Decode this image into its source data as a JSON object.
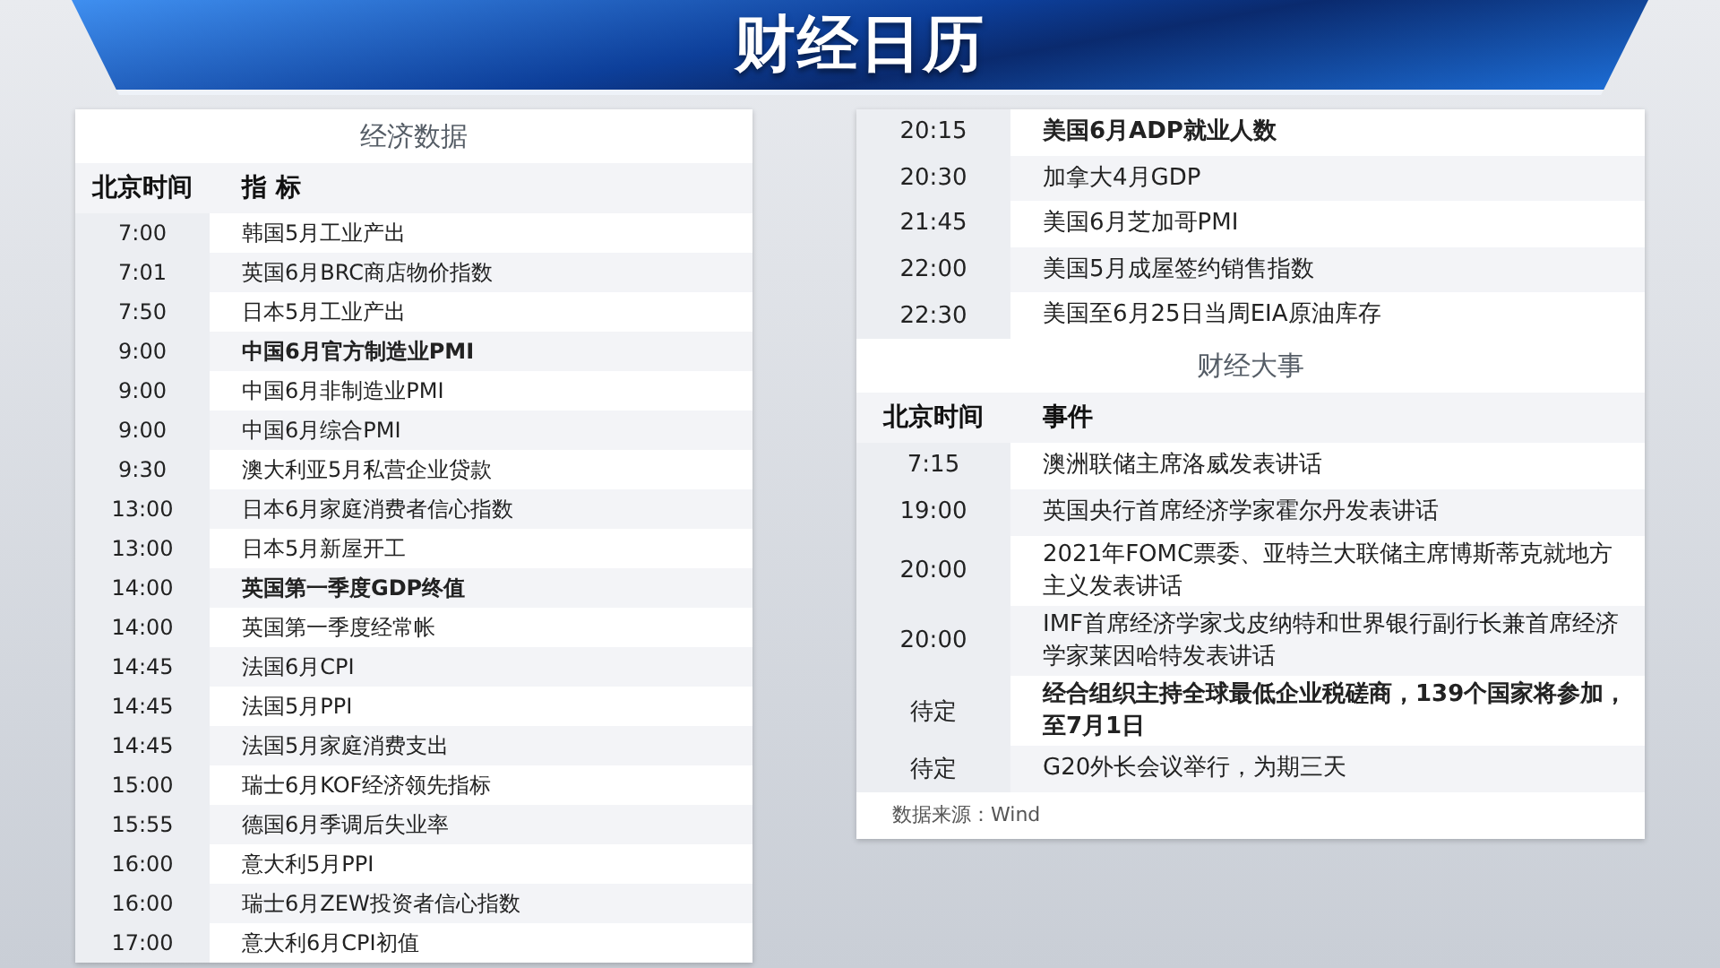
{
  "banner": {
    "title": "财经日历"
  },
  "economic_data": {
    "title": "经济数据",
    "columns": [
      "北京时间",
      "指 标"
    ],
    "rows": [
      {
        "time": "7:00",
        "item": "韩国5月工业产出",
        "bold": false
      },
      {
        "time": "7:01",
        "item": "英国6月BRC商店物价指数",
        "bold": false
      },
      {
        "time": "7:50",
        "item": "日本5月工业产出",
        "bold": false
      },
      {
        "time": "9:00",
        "item": "中国6月官方制造业PMI",
        "bold": true
      },
      {
        "time": "9:00",
        "item": "中国6月非制造业PMI",
        "bold": false
      },
      {
        "time": "9:00",
        "item": "中国6月综合PMI",
        "bold": false
      },
      {
        "time": "9:30",
        "item": "澳大利亚5月私营企业贷款",
        "bold": false
      },
      {
        "time": "13:00",
        "item": "日本6月家庭消费者信心指数",
        "bold": false
      },
      {
        "time": "13:00",
        "item": "日本5月新屋开工",
        "bold": false
      },
      {
        "time": "14:00",
        "item": "英国第一季度GDP终值",
        "bold": true
      },
      {
        "time": "14:00",
        "item": "英国第一季度经常帐",
        "bold": false
      },
      {
        "time": "14:45",
        "item": "法国6月CPI",
        "bold": false
      },
      {
        "time": "14:45",
        "item": "法国5月PPI",
        "bold": false
      },
      {
        "time": "14:45",
        "item": "法国5月家庭消费支出",
        "bold": false
      },
      {
        "time": "15:00",
        "item": "瑞士6月KOF经济领先指标",
        "bold": false
      },
      {
        "time": "15:55",
        "item": "德国6月季调后失业率",
        "bold": false
      },
      {
        "time": "16:00",
        "item": "意大利5月PPI",
        "bold": false
      },
      {
        "time": "16:00",
        "item": "瑞士6月ZEW投资者信心指数",
        "bold": false
      },
      {
        "time": "17:00",
        "item": "意大利6月CPI初值",
        "bold": false
      }
    ]
  },
  "economic_data_continued": {
    "rows": [
      {
        "time": "20:15",
        "item": "美国6月ADP就业人数",
        "bold": true
      },
      {
        "time": "20:30",
        "item": "加拿大4月GDP",
        "bold": false
      },
      {
        "time": "21:45",
        "item": "美国6月芝加哥PMI",
        "bold": false
      },
      {
        "time": "22:00",
        "item": "美国5月成屋签约销售指数",
        "bold": false
      },
      {
        "time": "22:30",
        "item": "美国至6月25日当周EIA原油库存",
        "bold": false
      }
    ]
  },
  "financial_events": {
    "title": "财经大事",
    "columns": [
      "北京时间",
      "事件"
    ],
    "rows": [
      {
        "time": "7:15",
        "item": "澳洲联储主席洛威发表讲话",
        "bold": false
      },
      {
        "time": "19:00",
        "item": "英国央行首席经济学家霍尔丹发表讲话",
        "bold": false
      },
      {
        "time": "20:00",
        "item": "2021年FOMC票委、亚特兰大联储主席博斯蒂克就地方主义发表讲话",
        "bold": false
      },
      {
        "time": "20:00",
        "item": "IMF首席经济学家戈皮纳特和世界银行副行长兼首席经济学家莱因哈特发表讲话",
        "bold": false
      },
      {
        "time": "待定",
        "item": "经合组织主持全球最低企业税磋商，139个国家将参加，至7月1日",
        "bold": true
      },
      {
        "time": "待定",
        "item": "G20外长会议举行，为期三天",
        "bold": false
      }
    ],
    "source": "数据来源：Wind"
  }
}
